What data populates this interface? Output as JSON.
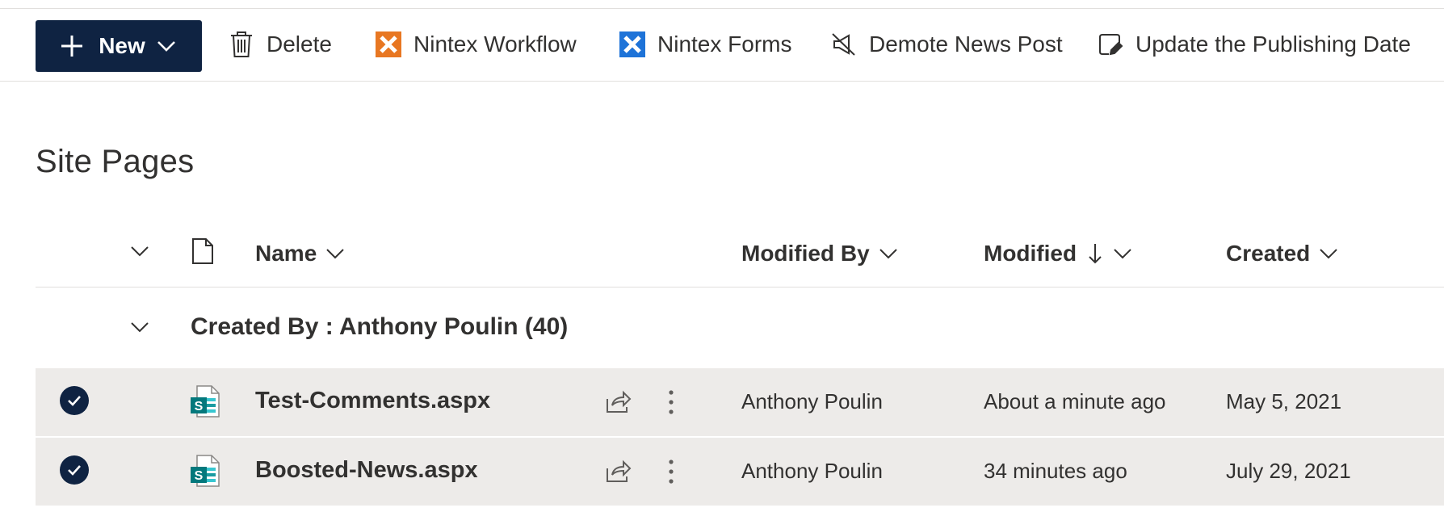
{
  "command_bar": {
    "new_label": "New",
    "delete_label": "Delete",
    "nintex_workflow_label": "Nintex Workflow",
    "nintex_forms_label": "Nintex Forms",
    "demote_label": "Demote News Post",
    "update_label": "Update the Publishing Date"
  },
  "page": {
    "title": "Site Pages"
  },
  "columns": {
    "name": "Name",
    "modified_by": "Modified By",
    "modified": "Modified",
    "created": "Created"
  },
  "group": {
    "label": "Created By : Anthony Poulin (40)"
  },
  "rows": [
    {
      "name": "Test-Comments.aspx",
      "modified_by": "Anthony Poulin",
      "modified": "About a minute ago",
      "created": "May 5, 2021",
      "selected": true
    },
    {
      "name": "Boosted-News.aspx",
      "modified_by": "Anthony Poulin",
      "modified": "34 minutes ago",
      "created": "July 29, 2021",
      "selected": true
    }
  ],
  "colors": {
    "primary": "#0f2342",
    "selected_row": "#edebe9",
    "nintex_workflow": "#e87722",
    "nintex_forms": "#1e73d8",
    "sharepoint_teal": "#03787c"
  },
  "icons": [
    "plus-icon",
    "chevron-down-icon",
    "trash-icon",
    "nintex-workflow-icon",
    "nintex-forms-icon",
    "demote-news-icon",
    "update-date-icon",
    "document-icon",
    "sharepoint-page-icon",
    "share-icon",
    "more-icon",
    "checkmark-icon",
    "sort-down-icon"
  ]
}
